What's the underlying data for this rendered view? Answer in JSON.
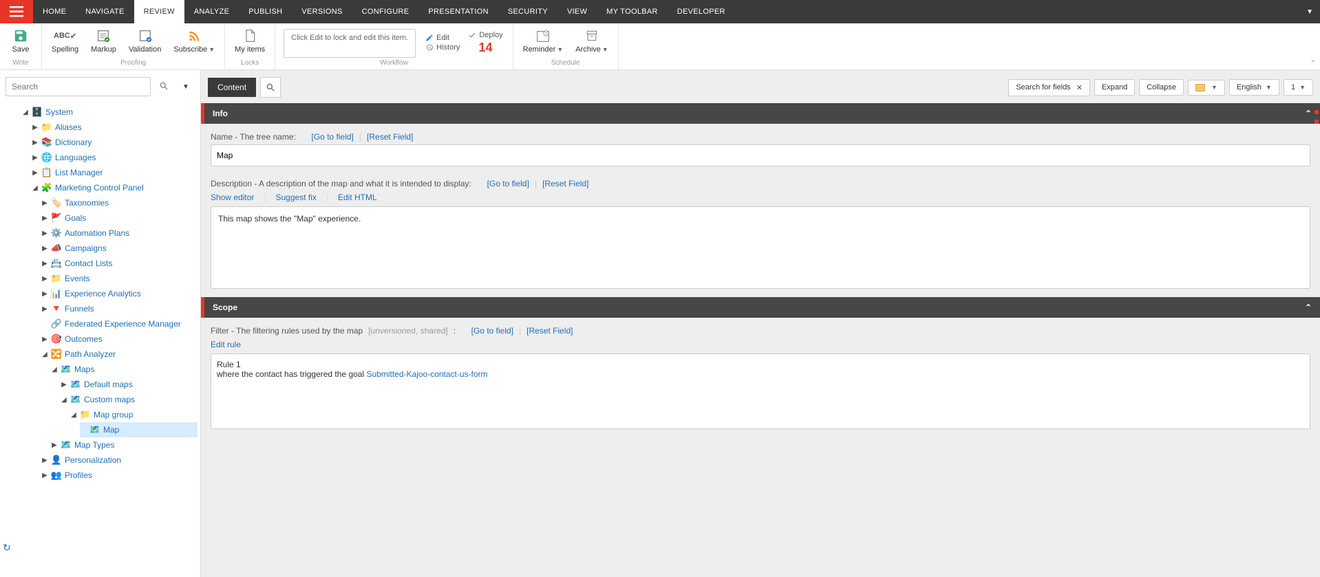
{
  "menu": {
    "tabs": [
      "HOME",
      "NAVIGATE",
      "REVIEW",
      "ANALYZE",
      "PUBLISH",
      "VERSIONS",
      "CONFIGURE",
      "PRESENTATION",
      "SECURITY",
      "VIEW",
      "MY TOOLBAR",
      "DEVELOPER"
    ],
    "active": "REVIEW"
  },
  "ribbon": {
    "save": {
      "label": "Save",
      "sub": "Write"
    },
    "proofing": {
      "spelling": "Spelling",
      "markup": "Markup",
      "validation": "Validation",
      "subscribe": "Subscribe",
      "group": "Proofing"
    },
    "locks": {
      "myitems": "My items",
      "group": "Locks"
    },
    "workflow": {
      "hint": "Click Edit to lock and edit this item.",
      "edit": "Edit",
      "history": "History",
      "deploy": "Deploy",
      "badge": "14",
      "group": "Workflow"
    },
    "schedule": {
      "reminder": "Reminder",
      "archive": "Archive",
      "group": "Schedule"
    }
  },
  "search": {
    "placeholder": "Search"
  },
  "tree": {
    "root": "System",
    "nodes": {
      "aliases": "Aliases",
      "dictionary": "Dictionary",
      "languages": "Languages",
      "listmgr": "List Manager",
      "mcp": "Marketing Control Panel",
      "taxonomies": "Taxonomies",
      "goals": "Goals",
      "automation": "Automation Plans",
      "campaigns": "Campaigns",
      "contacts": "Contact Lists",
      "events": "Events",
      "analytics": "Experience Analytics",
      "funnels": "Funnels",
      "fem": "Federated Experience Manager",
      "outcomes": "Outcomes",
      "path": "Path Analyzer",
      "maps": "Maps",
      "defaultmaps": "Default maps",
      "custommaps": "Custom maps",
      "mapgroup": "Map group",
      "map": "Map",
      "maptypes": "Map Types",
      "personalization": "Personalization",
      "profiles": "Profiles"
    }
  },
  "contentbar": {
    "content": "Content",
    "searchfields": "Search for fields",
    "expand": "Expand",
    "collapse": "Collapse",
    "language": "English",
    "version": "1"
  },
  "info": {
    "header": "Info",
    "name_label": "Name - The tree name:",
    "gotofield": "[Go to field]",
    "resetfield": "[Reset Field]",
    "name_value": "Map",
    "desc_label": "Description - A description of the map and what it is intended to display:",
    "show_editor": "Show editor",
    "suggest_fix": "Suggest fix",
    "edit_html": "Edit HTML",
    "desc_value": "This map shows the \"Map\" experience."
  },
  "scope": {
    "header": "Scope",
    "filter_label": "Filter - The filtering rules used by the map",
    "filter_meta": "[unversioned, shared]",
    "colon": ":",
    "gotofield": "[Go to field]",
    "resetfield": "[Reset Field]",
    "editrule": "Edit rule",
    "rule_title": "Rule 1",
    "rule_text_prefix": "where the contact has triggered the goal ",
    "rule_goal": "Submitted-Kajoo-contact-us-form"
  }
}
